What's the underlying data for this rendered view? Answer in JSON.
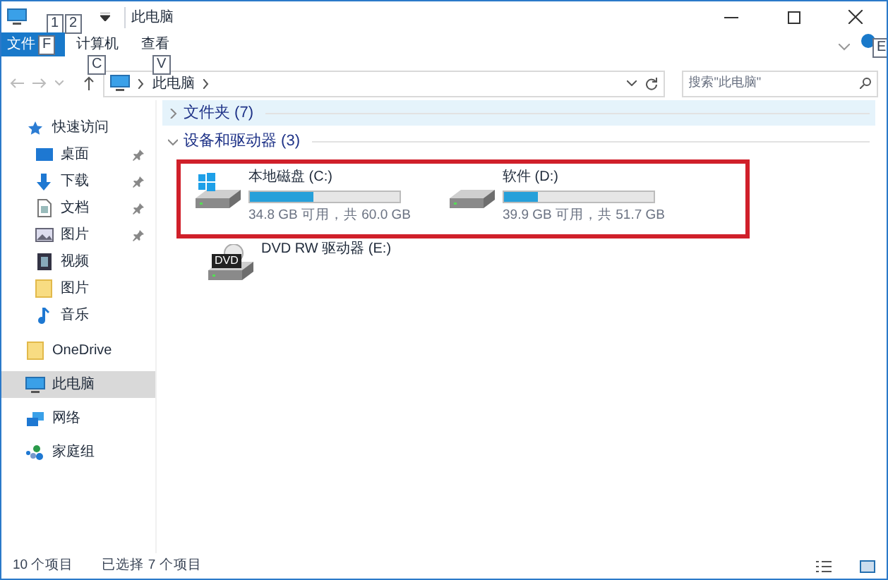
{
  "window": {
    "title": "此电脑",
    "keytips": [
      "1",
      "2"
    ]
  },
  "ribbon": {
    "tabs": [
      {
        "label": "文件",
        "keytip": "F",
        "selected": true
      },
      {
        "label": "计算机",
        "keytip": "C",
        "selected": false
      },
      {
        "label": "查看",
        "keytip": "V",
        "selected": false
      }
    ],
    "help_keytip": "E"
  },
  "address": {
    "path": "此电脑",
    "search_placeholder": "搜索\"此电脑\""
  },
  "sidebar": {
    "items": [
      {
        "kind": "star",
        "label": "快速访问",
        "pinned": false,
        "selected": false,
        "children": [
          {
            "kind": "desktop",
            "label": "桌面",
            "pinned": true,
            "selected": false
          },
          {
            "kind": "download",
            "label": "下载",
            "pinned": true,
            "selected": false
          },
          {
            "kind": "document",
            "label": "文档",
            "pinned": true,
            "selected": false
          },
          {
            "kind": "image",
            "label": "图片",
            "pinned": true,
            "selected": false
          },
          {
            "kind": "video",
            "label": "视频",
            "pinned": false,
            "selected": false
          },
          {
            "kind": "folder",
            "label": "图片",
            "pinned": false,
            "selected": false
          },
          {
            "kind": "music",
            "label": "音乐",
            "pinned": false,
            "selected": false
          }
        ]
      },
      {
        "kind": "folder",
        "label": "OneDrive",
        "pinned": false,
        "selected": false
      },
      {
        "kind": "pc",
        "label": "此电脑",
        "pinned": false,
        "selected": true
      },
      {
        "kind": "network",
        "label": "网络",
        "pinned": false,
        "selected": false
      },
      {
        "kind": "homegroup",
        "label": "家庭组",
        "pinned": false,
        "selected": false
      }
    ]
  },
  "groups": [
    {
      "label": "文件夹 (7)",
      "expanded": false,
      "selected": true
    },
    {
      "label": "设备和驱动器 (3)",
      "expanded": true,
      "selected": false
    }
  ],
  "drives": [
    {
      "kind": "system",
      "name": "本地磁盘 (C:)",
      "level": 0.42,
      "usage": "34.8 GB 可用，共 60.0 GB",
      "highlighted": true
    },
    {
      "kind": "disk",
      "name": "软件 (D:)",
      "level": 0.23,
      "usage": "39.9 GB 可用，共 51.7 GB",
      "highlighted": true
    },
    {
      "kind": "dvd",
      "name": "DVD RW 驱动器 (E:)",
      "badge": "DVD",
      "highlighted": false
    }
  ],
  "status_bar": {
    "count": "10 个项目",
    "selection": "已选择 7 个项目"
  }
}
